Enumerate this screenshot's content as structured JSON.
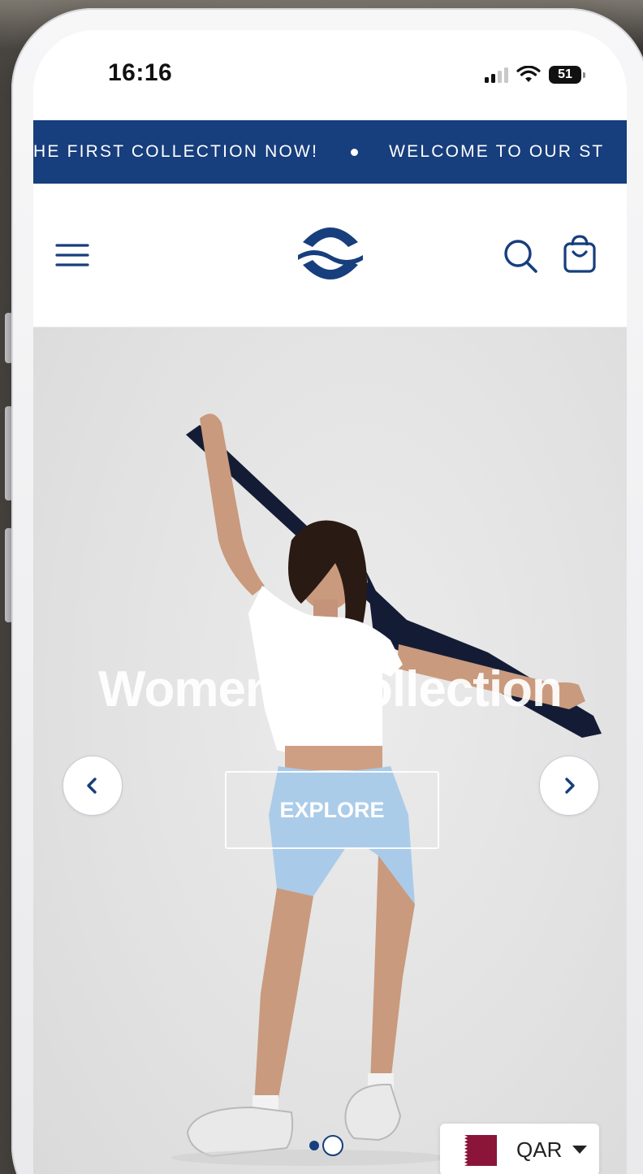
{
  "status_bar": {
    "time": "16:16",
    "battery": "51",
    "icons": [
      "signal-icon",
      "wifi-icon",
      "battery-icon"
    ]
  },
  "announcement": {
    "messages": [
      "HE FIRST COLLECTION NOW!",
      "WELCOME TO OUR ST"
    ]
  },
  "header": {
    "icons": [
      "menu-icon",
      "brand-logo",
      "search-icon",
      "cart-icon"
    ]
  },
  "hero": {
    "title": "Women's Collection",
    "button_label": "EXPLORE",
    "nav_icons": [
      "chevron-left-icon",
      "chevron-right-icon"
    ],
    "slides_total": 2,
    "slide_active": 1
  },
  "currency": {
    "code": "QAR",
    "flag": "qatar-flag",
    "icon": "caret-down-icon"
  },
  "colors": {
    "brand": "#173e7d",
    "hero_background": "#e4e4e4",
    "flag_maroon": "#8a1538"
  }
}
